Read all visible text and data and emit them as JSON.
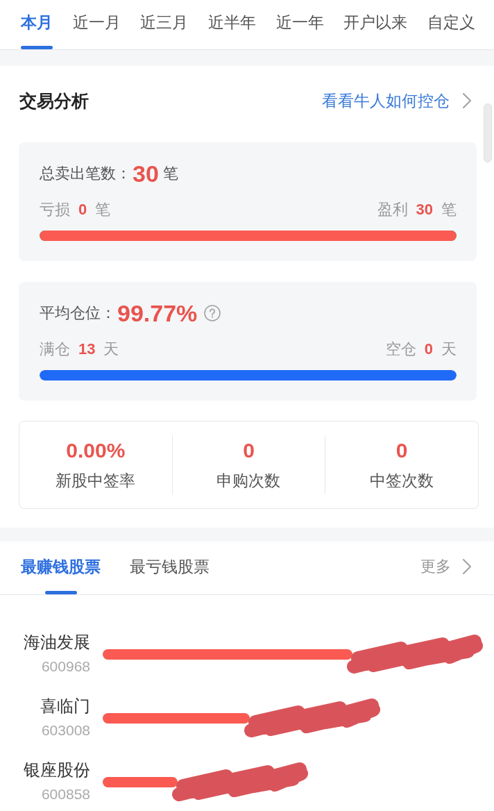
{
  "period_tabs": [
    {
      "label": "本月",
      "selected": true
    },
    {
      "label": "近一月",
      "selected": false
    },
    {
      "label": "近三月",
      "selected": false
    },
    {
      "label": "近半年",
      "selected": false
    },
    {
      "label": "近一年",
      "selected": false
    },
    {
      "label": "开户以来",
      "selected": false
    },
    {
      "label": "自定义",
      "selected": false
    }
  ],
  "trade_analysis": {
    "title": "交易分析",
    "link": "看看牛人如何控仓",
    "cards": [
      {
        "kind": "trades",
        "label": "总卖出笔数：",
        "value": "30",
        "unit": "笔",
        "help": false,
        "left": {
          "label": "亏损",
          "value": "0",
          "unit": "笔"
        },
        "right": {
          "label": "盈利",
          "value": "30",
          "unit": "笔"
        },
        "level": 1
      },
      {
        "kind": "position",
        "label": "平均仓位：",
        "value": "99.77%",
        "help": true,
        "left": {
          "label": "满仓",
          "value": "13",
          "unit": "天"
        },
        "right": {
          "label": "空仓",
          "value": "0",
          "unit": "天"
        },
        "level": 1
      }
    ],
    "ipo_stats": [
      {
        "value": "0.00%",
        "label": "新股中签率"
      },
      {
        "value": "0",
        "label": "申购次数"
      },
      {
        "value": "0",
        "label": "中签次数"
      }
    ]
  },
  "stock_tabs": [
    {
      "label": "最赚钱股票",
      "selected": true
    },
    {
      "label": "最亏钱股票",
      "selected": false
    }
  ],
  "more": "更多",
  "stocks": [
    {
      "name": "海油发展",
      "code": "600968",
      "redacted": true
    },
    {
      "name": "喜临门",
      "code": "603008",
      "redacted": true
    },
    {
      "name": "银座股份",
      "code": "600858",
      "redacted": true
    }
  ]
}
